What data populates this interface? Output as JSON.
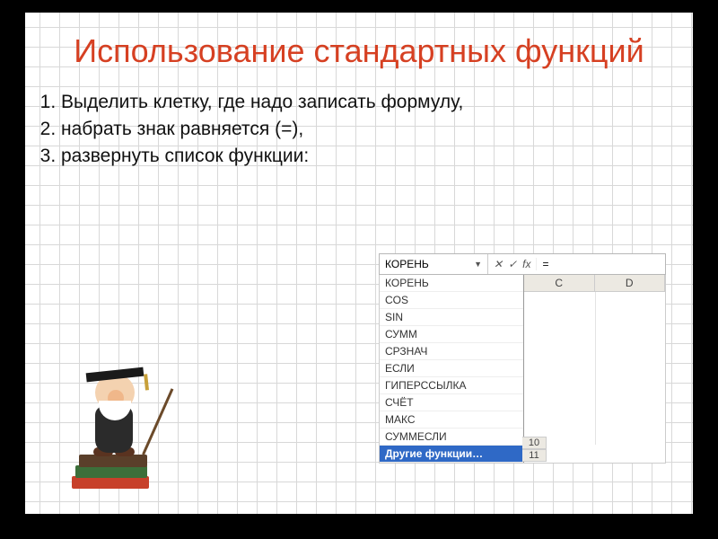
{
  "title": "Использование стандартных функций",
  "steps": [
    "Выделить клетку, где надо записать формулу,",
    "набрать знак равняется (=),",
    "развернуть список функции:"
  ],
  "excel": {
    "namebox": "КОРЕНЬ",
    "formula_value": "=",
    "fx_label": "fx",
    "cancel_glyph": "✕",
    "accept_glyph": "✓",
    "columns": [
      "C",
      "D"
    ],
    "dropdown": [
      "КОРЕНЬ",
      "COS",
      "SIN",
      "СУММ",
      "СРЗНАЧ",
      "ЕСЛИ",
      "ГИПЕРССЫЛКА",
      "СЧЁТ",
      "МАКС",
      "СУММЕСЛИ",
      "Другие функции…"
    ],
    "dropdown_selected_index": 10,
    "tail_rows": [
      "10",
      "11"
    ]
  }
}
